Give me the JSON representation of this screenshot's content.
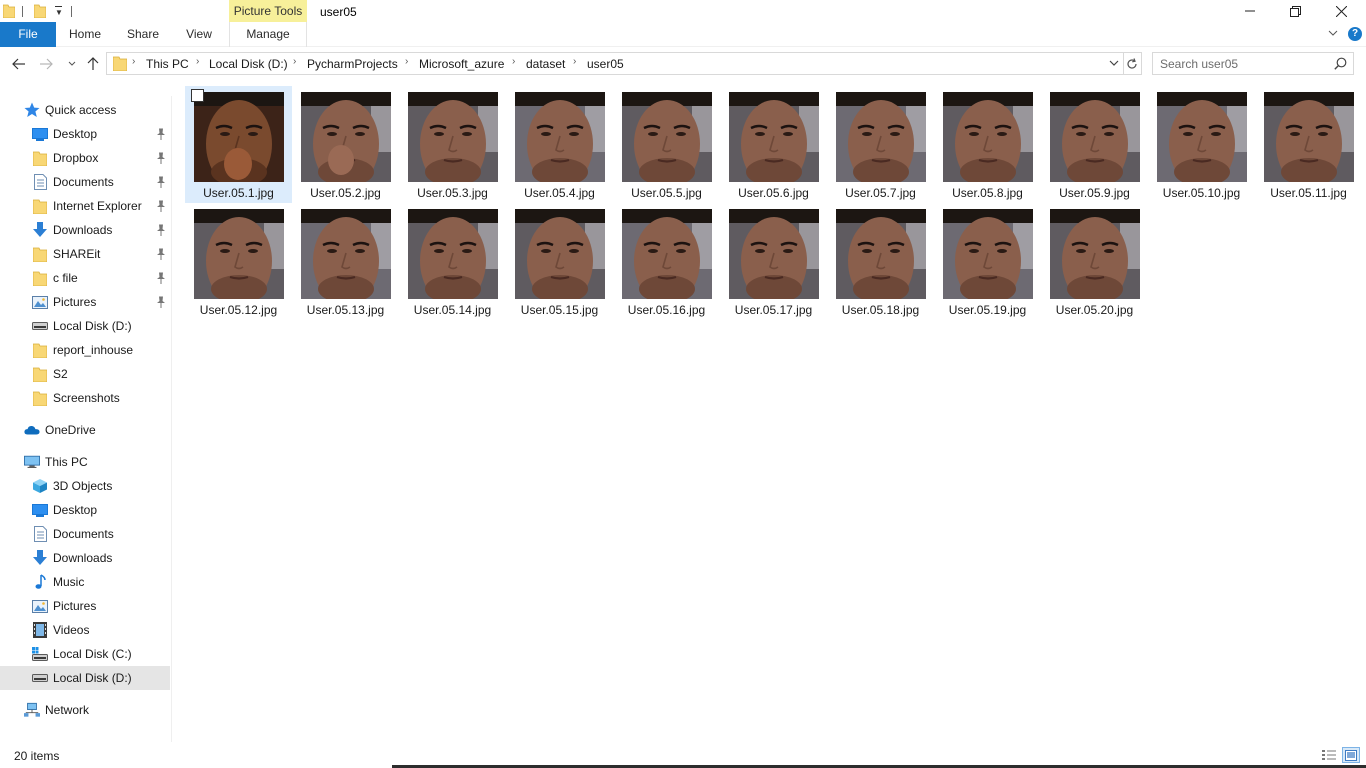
{
  "window": {
    "context_tab": "Picture Tools",
    "title": "user05"
  },
  "ribbon": {
    "tabs": [
      "File",
      "Home",
      "Share",
      "View",
      "Manage"
    ]
  },
  "address": {
    "path": [
      "This PC",
      "Local Disk (D:)",
      "PycharmProjects",
      "Microsoft_azure",
      "dataset",
      "user05"
    ]
  },
  "search": {
    "placeholder": "Search user05"
  },
  "nav": {
    "quick_access": {
      "label": "Quick access",
      "items": [
        {
          "label": "Desktop",
          "icon": "desktop-icon",
          "pinned": true
        },
        {
          "label": "Dropbox",
          "icon": "folder-icon",
          "pinned": true
        },
        {
          "label": "Documents",
          "icon": "documents-icon",
          "pinned": true
        },
        {
          "label": "Internet Explorer",
          "icon": "folder-icon",
          "pinned": true
        },
        {
          "label": "Downloads",
          "icon": "downloads-icon",
          "pinned": true
        },
        {
          "label": "SHAREit",
          "icon": "folder-icon",
          "pinned": true
        },
        {
          "label": "c file",
          "icon": "folder-icon",
          "pinned": true
        },
        {
          "label": "Pictures",
          "icon": "pictures-icon",
          "pinned": true
        },
        {
          "label": "Local Disk (D:)",
          "icon": "drive-icon",
          "pinned": false
        },
        {
          "label": "report_inhouse",
          "icon": "folder-icon",
          "pinned": false
        },
        {
          "label": "S2",
          "icon": "folder-icon",
          "pinned": false
        },
        {
          "label": "Screenshots",
          "icon": "folder-icon",
          "pinned": false
        }
      ]
    },
    "onedrive": {
      "label": "OneDrive"
    },
    "this_pc": {
      "label": "This PC",
      "items": [
        {
          "label": "3D Objects",
          "icon": "3d-objects-icon"
        },
        {
          "label": "Desktop",
          "icon": "desktop-icon"
        },
        {
          "label": "Documents",
          "icon": "documents-icon"
        },
        {
          "label": "Downloads",
          "icon": "downloads-icon"
        },
        {
          "label": "Music",
          "icon": "music-icon"
        },
        {
          "label": "Pictures",
          "icon": "pictures-icon"
        },
        {
          "label": "Videos",
          "icon": "videos-icon"
        },
        {
          "label": "Local Disk (C:)",
          "icon": "system-drive-icon"
        },
        {
          "label": "Local Disk (D:)",
          "icon": "drive-icon",
          "selected": true
        }
      ]
    },
    "network": {
      "label": "Network"
    }
  },
  "files": [
    "User.05.1.jpg",
    "User.05.2.jpg",
    "User.05.3.jpg",
    "User.05.4.jpg",
    "User.05.5.jpg",
    "User.05.6.jpg",
    "User.05.7.jpg",
    "User.05.8.jpg",
    "User.05.9.jpg",
    "User.05.10.jpg",
    "User.05.11.jpg",
    "User.05.12.jpg",
    "User.05.13.jpg",
    "User.05.14.jpg",
    "User.05.15.jpg",
    "User.05.16.jpg",
    "User.05.17.jpg",
    "User.05.18.jpg",
    "User.05.19.jpg",
    "User.05.20.jpg"
  ],
  "selected_file": "User.05.1.jpg",
  "status": {
    "item_count": "20 items"
  },
  "colors": {
    "accent": "#1979ca",
    "context_tab": "#f7f09a",
    "selection": "#dcecfc",
    "nav_selected": "#e5e5e5",
    "folder": "#f8d775"
  }
}
